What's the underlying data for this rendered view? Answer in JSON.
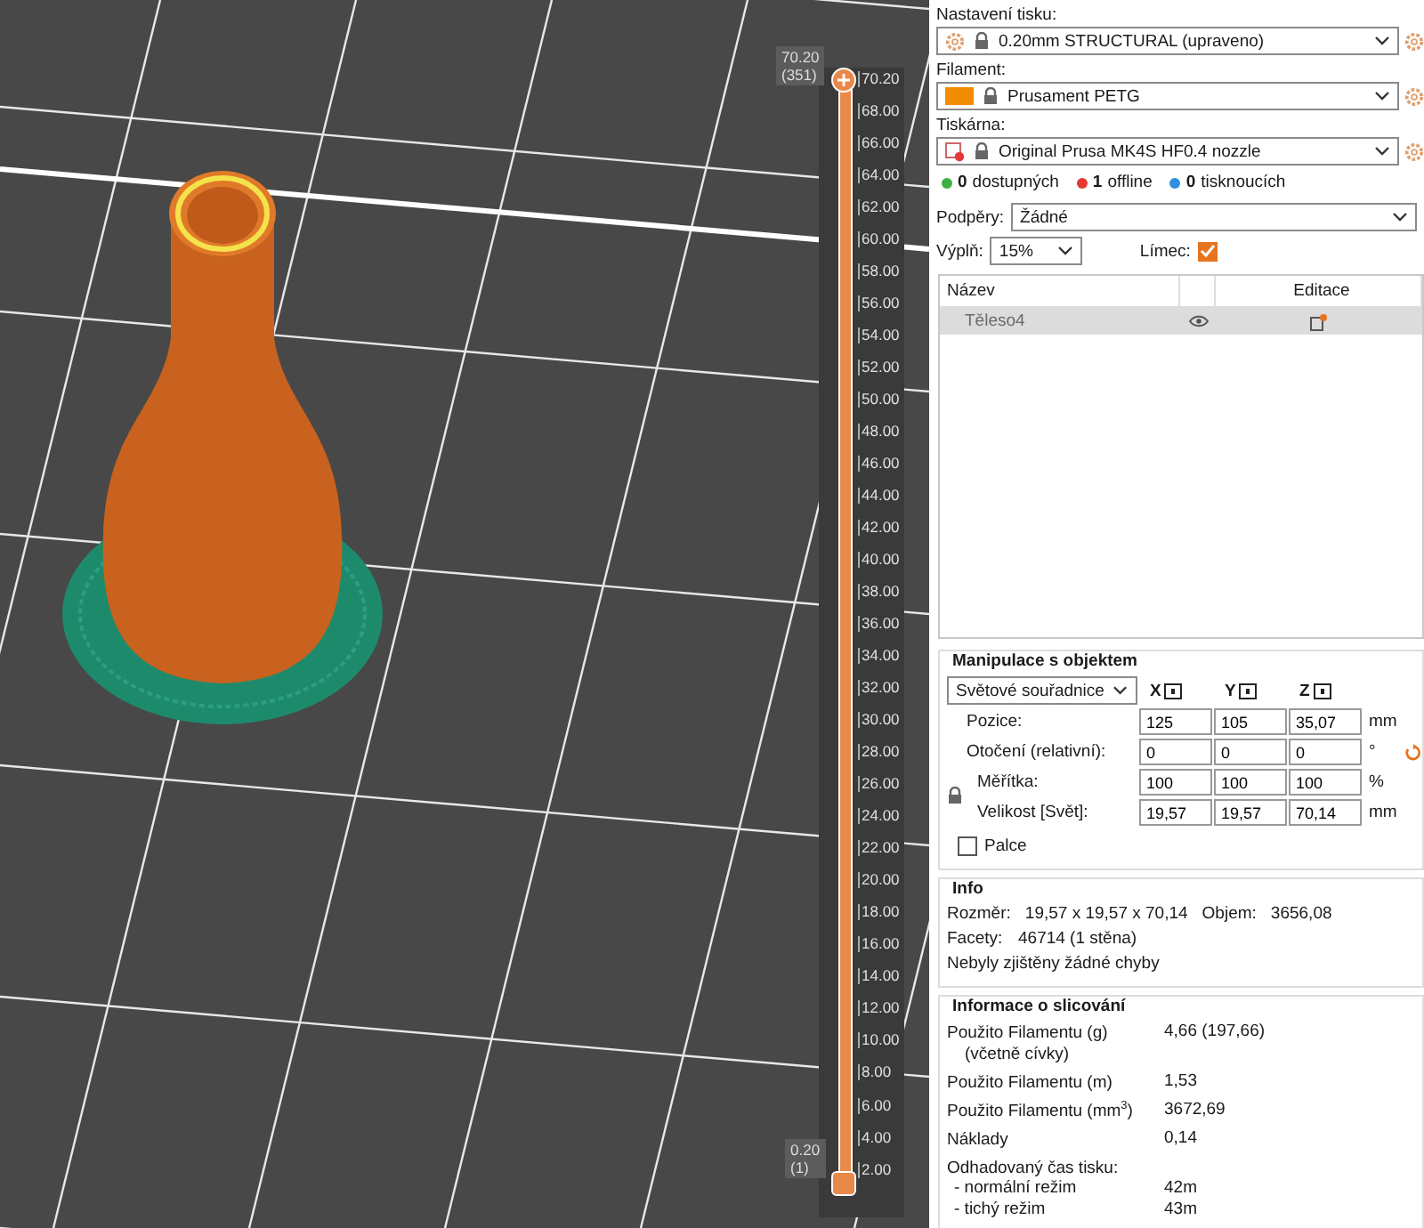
{
  "viewport": {
    "layer_slider": {
      "upper_value": "70.20",
      "upper_layer": "(351)",
      "lower_value": "0.20",
      "lower_layer": "(1)",
      "level": 1,
      "ticks": [
        "70.20",
        "68.00",
        "66.00",
        "64.00",
        "62.00",
        "60.00",
        "58.00",
        "56.00",
        "54.00",
        "52.00",
        "50.00",
        "48.00",
        "46.00",
        "44.00",
        "42.00",
        "40.00",
        "38.00",
        "36.00",
        "34.00",
        "32.00",
        "30.00",
        "28.00",
        "26.00",
        "24.00",
        "22.00",
        "20.00",
        "18.00",
        "16.00",
        "14.00",
        "12.00",
        "10.00",
        "8.00",
        "6.00",
        "4.00",
        "2.00"
      ]
    }
  },
  "panel": {
    "print_settings": {
      "label": "Nastavení tisku:",
      "value": "0.20mm STRUCTURAL (upraveno)"
    },
    "filament": {
      "label": "Filament:",
      "value": "Prusament PETG"
    },
    "printer": {
      "label": "Tiskárna:",
      "value": "Original Prusa MK4S HF0.4 nozzle"
    },
    "printer_status": [
      {
        "count": "0",
        "text": "dostupných",
        "color": "#3cb043"
      },
      {
        "count": "1",
        "text": "offline",
        "color": "#e53935"
      },
      {
        "count": "0",
        "text": "tisknoucích",
        "color": "#2f8ee0"
      }
    ],
    "supports": {
      "label": "Podpěry:",
      "value": "Žádné"
    },
    "infill": {
      "label": "Výplň:",
      "value": "15%"
    },
    "brim": {
      "label": "Límec:",
      "checked": true
    },
    "object_list": {
      "columns": [
        "Název",
        "Editace"
      ],
      "rows": [
        {
          "name": "Těleso4",
          "selected": true
        }
      ]
    },
    "manipulation": {
      "title": "Manipulace s objektem",
      "coordinates": "Světové souřadnice",
      "axes": [
        "X",
        "Y",
        "Z"
      ],
      "rows": [
        {
          "kind": "plain",
          "label": "Pozice:",
          "values": [
            "125",
            "105",
            "35,07"
          ],
          "unit": "mm"
        },
        {
          "kind": "reset",
          "label": "Otočení (relativní):",
          "values": [
            "0",
            "0",
            "0"
          ],
          "unit": "°"
        },
        {
          "kind": "locked",
          "label": "Měřítka:",
          "values": [
            "100",
            "100",
            "100"
          ],
          "unit": "%"
        },
        {
          "kind": "locked",
          "label": "Velikost [Svět]:",
          "values": [
            "19,57",
            "19,57",
            "70,14"
          ],
          "unit": "mm"
        }
      ],
      "inches": {
        "label": "Palce",
        "checked": false
      }
    },
    "info": {
      "title": "Info",
      "size_label": "Rozměr:",
      "size": "19,57 x 19,57 x 70,14",
      "volume_label": "Objem:",
      "volume": "3656,08",
      "facets_label": "Facety:",
      "facets": "46714 (1 stěna)",
      "message": "Nebyly zjištěny žádné chyby"
    },
    "slicing": {
      "title": "Informace o slicování",
      "rows": [
        {
          "label": "Použito Filamentu (g)",
          "sublabel": "(včetně cívky)",
          "value": "4,66 (197,66)"
        },
        {
          "label": "Použito Filamentu (m)",
          "value": "1,53"
        },
        {
          "label": "Použito Filamentu (mm$^{3}$)",
          "value": "3672,69"
        },
        {
          "label": "Náklady",
          "value": "0,14"
        }
      ],
      "time": {
        "label": "Odhadovaný čas tisku:",
        "modes": [
          {
            "label": "- normální režim",
            "value": "42m"
          },
          {
            "label": "- tichý režim",
            "value": "43m"
          }
        ]
      }
    }
  }
}
